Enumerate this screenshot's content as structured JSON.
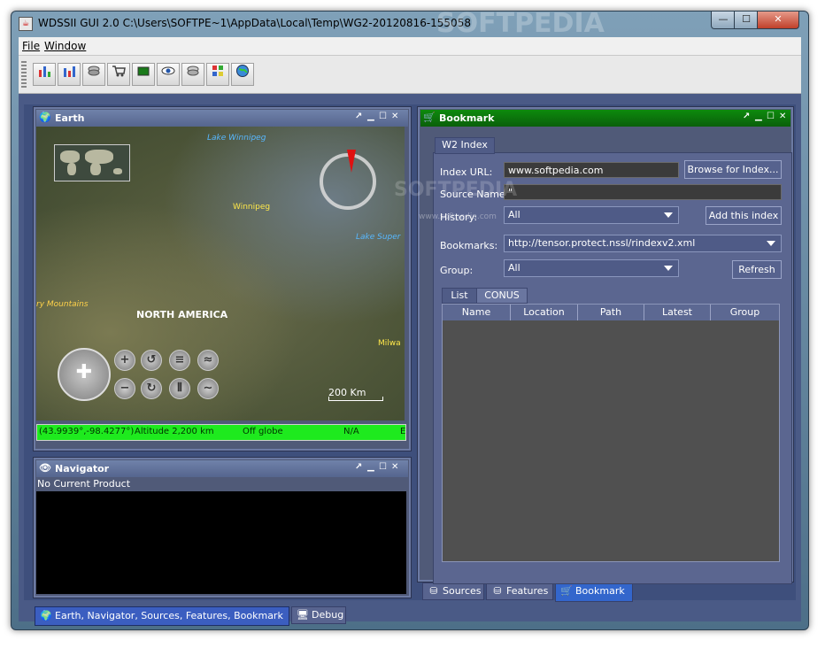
{
  "window": {
    "title": "WDSSII GUI 2.0 C:\\Users\\SOFTPE~1\\AppData\\Local\\Temp\\WG2-20120816-155058",
    "watermark": "SOFTPEDIA",
    "controls": {
      "minimize": "—",
      "maximize": "☐",
      "close": "✕"
    }
  },
  "menu": {
    "file": "File",
    "window": "Window"
  },
  "toolbar": {
    "buttons": [
      {
        "icon": "bar-chart-icon"
      },
      {
        "icon": "bar-chart-icon"
      },
      {
        "icon": "layers-icon"
      },
      {
        "icon": "cart-icon"
      },
      {
        "icon": "film-icon"
      },
      {
        "icon": "eye-icon"
      },
      {
        "icon": "layers-icon"
      },
      {
        "icon": "grid-icon"
      },
      {
        "icon": "globe-icon"
      }
    ]
  },
  "earth": {
    "title": "Earth",
    "labels": {
      "lake_winnipeg": "Lake Winnipeg",
      "winnipeg": "Winnipeg",
      "lake_superior": "Lake Super",
      "mountains": "ry Mountains",
      "north_america": "NORTH AMERICA",
      "milwaukee": "Milwa"
    },
    "scale": "200 Km",
    "status": {
      "coords": "(43.9939°,-98.4277°)",
      "altitude": "Altitude   2,200 km",
      "globe": "Off globe",
      "na": "N/A",
      "extra": "E"
    }
  },
  "navigator": {
    "title": "Navigator",
    "product": "No Current Product"
  },
  "bookmark": {
    "title": "Bookmark",
    "tab_w2": "W2 Index",
    "index_url_label": "Index URL:",
    "index_url_value": "www.softpedia.com",
    "browse_button": "Browse for Index...",
    "source_name_label": "Source Name:",
    "source_name_value": "\"",
    "history_label": "History:",
    "history_value": "All",
    "add_index_button": "Add this index",
    "bookmarks_label": "Bookmarks:",
    "bookmarks_value": "http://tensor.protect.nssl/rindexv2.xml",
    "group_label": "Group:",
    "group_value": "All",
    "refresh_button": "Refresh",
    "subtabs": {
      "list": "List",
      "conus": "CONUS"
    },
    "columns": [
      "Name",
      "Location",
      "Path",
      "Latest",
      "Group"
    ],
    "watermark_url": "www.softpedia.com"
  },
  "bottom_tabs": {
    "sources": "Sources",
    "features": "Features",
    "bookmark": "Bookmark"
  },
  "desk_tabs": {
    "main": "Earth, Navigator, Sources, Features, Bookmark",
    "debug": "Debug"
  }
}
